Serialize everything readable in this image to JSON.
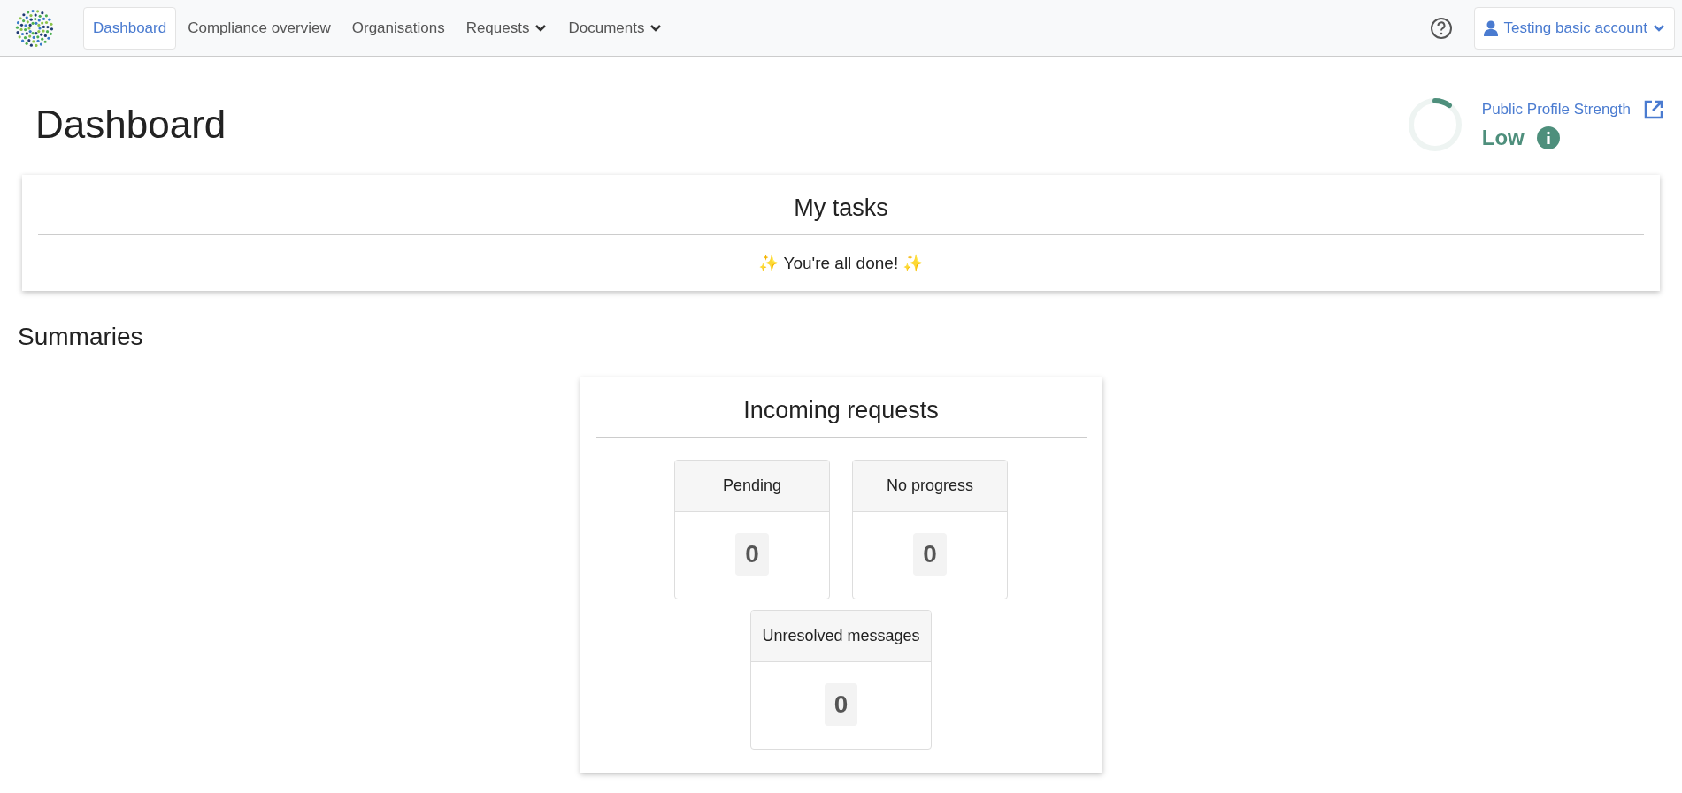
{
  "nav": {
    "items": [
      {
        "label": "Dashboard",
        "selected": true,
        "kind": "link"
      },
      {
        "label": "Compliance overview",
        "selected": false,
        "kind": "link"
      },
      {
        "label": "Organisations",
        "selected": false,
        "kind": "link"
      },
      {
        "label": "Requests",
        "selected": false,
        "kind": "dropdown"
      },
      {
        "label": "Documents",
        "selected": false,
        "kind": "dropdown"
      }
    ],
    "account": {
      "label": "Testing basic account"
    }
  },
  "page": {
    "title": "Dashboard"
  },
  "profile_strength": {
    "label": "Public Profile Strength",
    "rating": "Low",
    "level": 0.1
  },
  "tasks": {
    "title": "My tasks",
    "message": "✨ You're all done! ✨"
  },
  "summaries": {
    "title": "Summaries",
    "card": {
      "title": "Incoming requests",
      "tiles": [
        {
          "label": "Pending",
          "value": "0"
        },
        {
          "label": "No progress",
          "value": "0"
        },
        {
          "label": "Unresolved messages",
          "value": "0"
        }
      ]
    }
  }
}
